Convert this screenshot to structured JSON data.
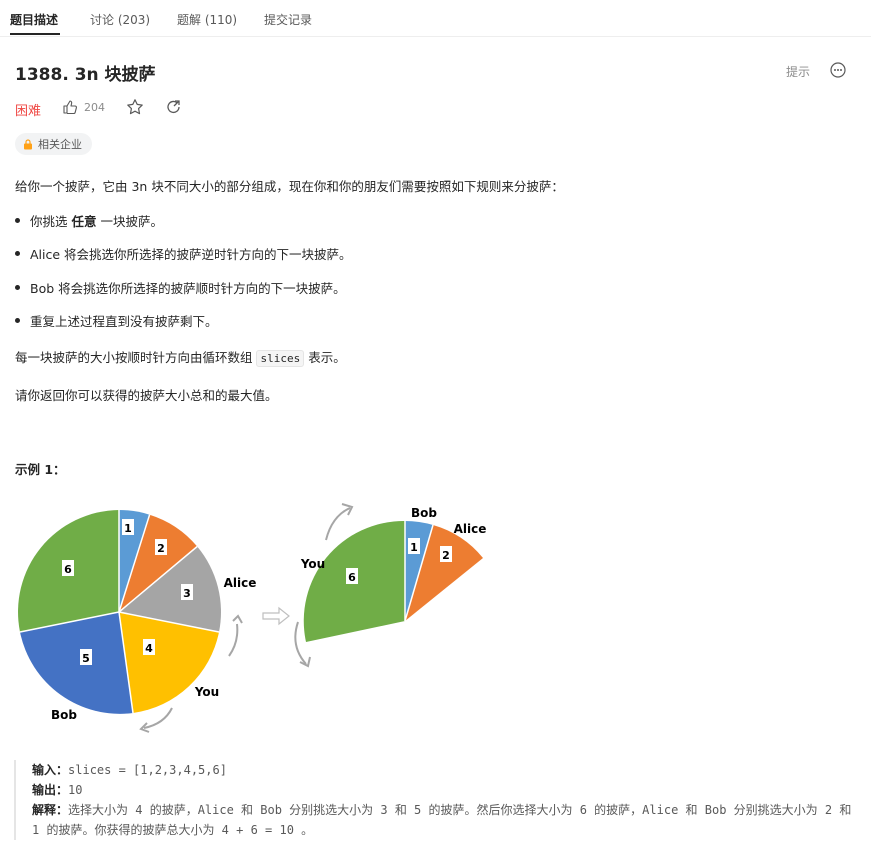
{
  "tabs": [
    {
      "label": "题目描述",
      "active": true
    },
    {
      "label": "讨论 (203)",
      "active": false
    },
    {
      "label": "题解 (110)",
      "active": false
    },
    {
      "label": "提交记录",
      "active": false
    }
  ],
  "problem": {
    "title": "1388. 3n 块披萨",
    "hint_label": "提示",
    "difficulty": "困难",
    "like_count": "204",
    "company_tag": "相关企业"
  },
  "description": {
    "intro": "给你一个披萨，它由 3n 块不同大小的部分组成，现在你和你的朋友们需要按照如下规则来分披萨：",
    "rule1_before": "你挑选 ",
    "rule1_bold": "任意",
    "rule1_after": " 一块披萨。",
    "rule2": "Alice 将会挑选你所选择的披萨逆时针方向的下一块披萨。",
    "rule3": "Bob 将会挑选你所选择的披萨顺时针方向的下一块披萨。",
    "rule4": "重复上述过程直到没有披萨剩下。",
    "para2_before": "每一块披萨的大小按顺时针方向由循环数组 ",
    "para2_code": "slices",
    "para2_after": " 表示。",
    "para3": "请你返回你可以获得的披萨大小总和的最大值。"
  },
  "example": {
    "title": "示例 1：",
    "figure": {
      "pie1_labels": [
        "1",
        "2",
        "3",
        "4",
        "5",
        "6"
      ],
      "pie2_labels": [
        "1",
        "2",
        "6"
      ],
      "names": {
        "alice": "Alice",
        "you": "You",
        "bob": "Bob"
      }
    },
    "input_label": "输入：",
    "input_value": "slices = [1,2,3,4,5,6]",
    "output_label": "输出：",
    "output_value": "10",
    "explain_label": "解释：",
    "explain_value": "选择大小为 4 的披萨，Alice 和 Bob 分别挑选大小为 3 和 5 的披萨。然后你选择大小为 6 的披萨，Alice 和 Bob 分别挑选大小为 2 和 1 的披萨。你获得的披萨总大小为 4 + 6 = 10 。"
  },
  "colors": {
    "difficulty": "#ef4743",
    "slice1": "#5b9bd5",
    "slice2": "#ed7d31",
    "slice3": "#a5a5a5",
    "slice4": "#ffc000",
    "slice5": "#4472c4",
    "slice6": "#70ad47"
  }
}
